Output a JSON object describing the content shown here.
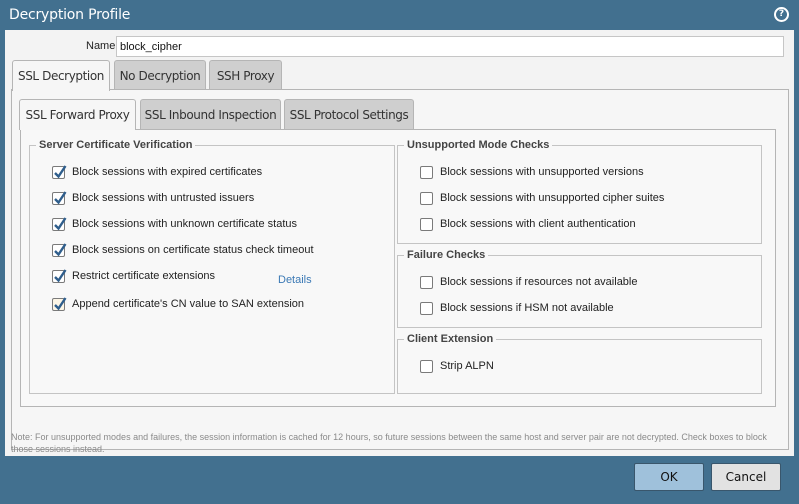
{
  "window": {
    "title": "Decryption Profile",
    "help_symbol": "?"
  },
  "name_field": {
    "label": "Name",
    "value": "block_cipher"
  },
  "top_tabs": [
    {
      "label": "SSL Decryption",
      "active": true
    },
    {
      "label": "No Decryption",
      "active": false
    },
    {
      "label": "SSH Proxy",
      "active": false
    }
  ],
  "sub_tabs": [
    {
      "label": "SSL Forward Proxy",
      "active": true
    },
    {
      "label": "SSL Inbound Inspection",
      "active": false
    },
    {
      "label": "SSL Protocol Settings",
      "active": false
    }
  ],
  "server_cert": {
    "title": "Server Certificate Verification",
    "items": [
      {
        "label": "Block sessions with expired certificates",
        "checked": true
      },
      {
        "label": "Block sessions with untrusted issuers",
        "checked": true
      },
      {
        "label": "Block sessions with unknown certificate status",
        "checked": true
      },
      {
        "label": "Block sessions on certificate status check timeout",
        "checked": true
      },
      {
        "label": "Restrict certificate extensions",
        "checked": true
      },
      {
        "label": "Append certificate's CN value to SAN extension",
        "checked": true
      }
    ],
    "details_link": "Details"
  },
  "unsupported": {
    "title": "Unsupported Mode Checks",
    "items": [
      {
        "label": "Block sessions with unsupported versions",
        "checked": false
      },
      {
        "label": "Block sessions with unsupported cipher suites",
        "checked": false
      },
      {
        "label": "Block sessions with client authentication",
        "checked": false
      }
    ]
  },
  "failure": {
    "title": "Failure Checks",
    "items": [
      {
        "label": "Block sessions if resources not available",
        "checked": false
      },
      {
        "label": "Block sessions if HSM not available",
        "checked": false
      }
    ]
  },
  "client_ext": {
    "title": "Client Extension",
    "items": [
      {
        "label": "Strip ALPN",
        "checked": false
      }
    ]
  },
  "note": "Note: For unsupported modes and failures, the session information is cached for 12 hours, so future sessions between the same host and server pair are not decrypted. Check boxes to block those sessions instead.",
  "buttons": {
    "ok": "OK",
    "cancel": "Cancel"
  },
  "colors": {
    "titlebar": "#42708f",
    "link": "#3b79b5",
    "ok_button": "#9fc1db"
  }
}
